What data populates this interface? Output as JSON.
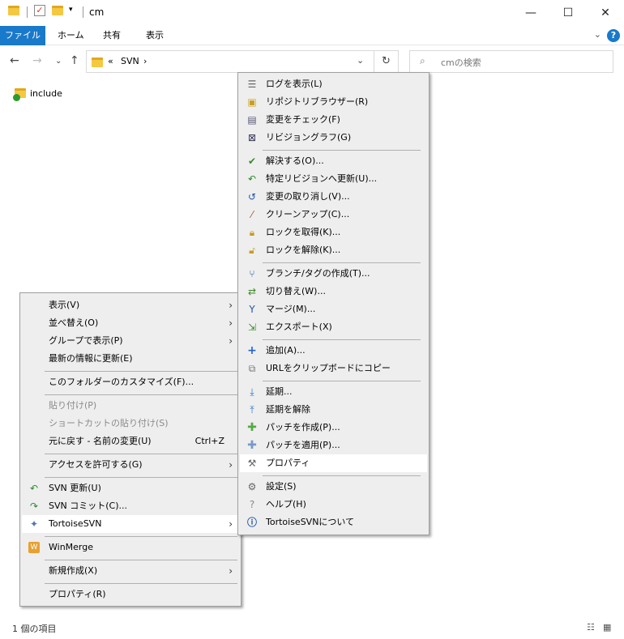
{
  "window": {
    "title": "cm"
  },
  "ribbon": {
    "tabs": [
      "ファイル",
      "ホーム",
      "共有",
      "表示"
    ]
  },
  "address": {
    "prefix": "«",
    "crumb": "SVN",
    "sep": "›"
  },
  "search": {
    "placeholder": "cmの検索"
  },
  "files": [
    {
      "name": "include"
    }
  ],
  "status": {
    "count": "1 個の項目"
  },
  "context_menu": {
    "items": [
      {
        "label": "表示(V)",
        "submenu": true
      },
      {
        "label": "並べ替え(O)",
        "submenu": true
      },
      {
        "label": "グループで表示(P)",
        "submenu": true
      },
      {
        "label": "最新の情報に更新(E)"
      },
      {
        "label": "このフォルダーのカスタマイズ(F)..."
      },
      {
        "label": "貼り付け(P)",
        "disabled": true
      },
      {
        "label": "ショートカットの貼り付け(S)",
        "disabled": true
      },
      {
        "label": "元に戻す - 名前の変更(U)",
        "shortcut": "Ctrl+Z"
      },
      {
        "label": "アクセスを許可する(G)",
        "submenu": true
      },
      {
        "label": "SVN 更新(U)"
      },
      {
        "label": "SVN コミット(C)..."
      },
      {
        "label": "TortoiseSVN",
        "submenu": true
      },
      {
        "label": "WinMerge"
      },
      {
        "label": "新規作成(X)",
        "submenu": true
      },
      {
        "label": "プロパティ(R)"
      }
    ]
  },
  "svn_menu": {
    "items": [
      {
        "label": "ログを表示(L)"
      },
      {
        "label": "リポジトリブラウザー(R)"
      },
      {
        "label": "変更をチェック(F)"
      },
      {
        "label": "リビジョングラフ(G)"
      },
      {
        "label": "解決する(O)..."
      },
      {
        "label": "特定リビジョンへ更新(U)..."
      },
      {
        "label": "変更の取り消し(V)..."
      },
      {
        "label": "クリーンアップ(C)..."
      },
      {
        "label": "ロックを取得(K)..."
      },
      {
        "label": "ロックを解除(K)..."
      },
      {
        "label": "ブランチ/タグの作成(T)..."
      },
      {
        "label": "切り替え(W)..."
      },
      {
        "label": "マージ(M)..."
      },
      {
        "label": "エクスポート(X)"
      },
      {
        "label": "追加(A)..."
      },
      {
        "label": "URLをクリップボードにコピー"
      },
      {
        "label": "延期..."
      },
      {
        "label": "延期を解除"
      },
      {
        "label": "パッチを作成(P)..."
      },
      {
        "label": "パッチを適用(P)..."
      },
      {
        "label": "プロパティ"
      },
      {
        "label": "設定(S)"
      },
      {
        "label": "ヘルプ(H)"
      },
      {
        "label": "TortoiseSVNについて"
      }
    ]
  },
  "colors": {
    "accent": "#1979ca",
    "folder": "#f5c842",
    "menu_bg": "#eeeeee"
  }
}
